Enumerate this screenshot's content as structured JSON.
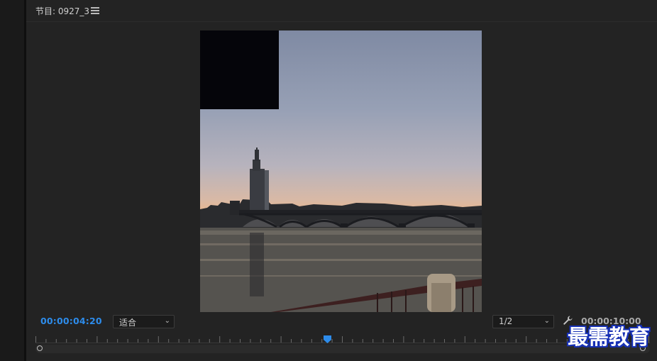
{
  "panel": {
    "title": "节目: 0927_3"
  },
  "controls": {
    "current_timecode": "00:00:04:20",
    "zoom_select_value": "适合",
    "resolution_select_value": "1/2",
    "duration_timecode": "00:00:10:00"
  },
  "playhead": {
    "position_fraction": 0.475
  },
  "watermark": {
    "text": "最需教育"
  },
  "colors": {
    "accent_blue": "#2d8ceb",
    "panel_bg": "#232323",
    "watermark_blue": "#1730b5"
  },
  "icons": [
    "hamburger-menu-icon",
    "chevron-down-icon",
    "wrench-icon",
    "playhead-icon"
  ]
}
